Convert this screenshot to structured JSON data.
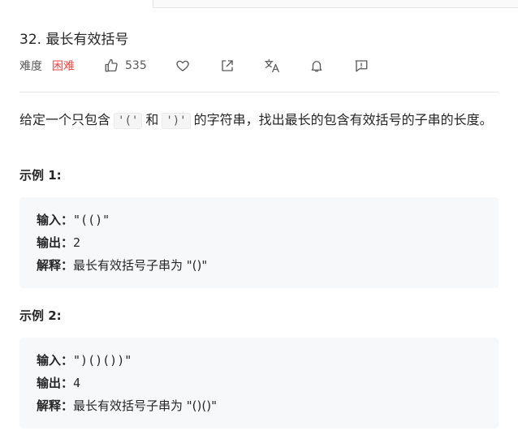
{
  "problem": {
    "title": "32. 最长有效括号",
    "difficulty_label": "难度",
    "difficulty_value": "困难",
    "likes": "535"
  },
  "toolbar_icons": [
    "thumbs-up-icon",
    "heart-icon",
    "share-icon",
    "translate-icon",
    "bell-icon",
    "feedback-icon"
  ],
  "description": {
    "prefix": "给定一个只包含",
    "code1": "'('",
    "and": "和",
    "code2": "')'",
    "suffix": "的字符串，找出最长的包含有效括号的子串的长度。"
  },
  "examples": [
    {
      "title": "示例 1:",
      "input_label": "输入：",
      "input_value": "\"(()\"",
      "output_label": "输出：",
      "output_value": "2",
      "explain_label": "解释：",
      "explain_value": "最长有效括号子串为 \"()\""
    },
    {
      "title": "示例 2:",
      "input_label": "输入：",
      "input_value": "\")()())\"",
      "output_label": "输出：",
      "output_value": "4",
      "explain_label": "解释：",
      "explain_value": "最长有效括号子串为 \"()()\""
    }
  ],
  "colors": {
    "difficulty_hard": "#ef4743",
    "example_bg": "#f7f8fa",
    "text": "#262626",
    "muted": "#595959"
  }
}
